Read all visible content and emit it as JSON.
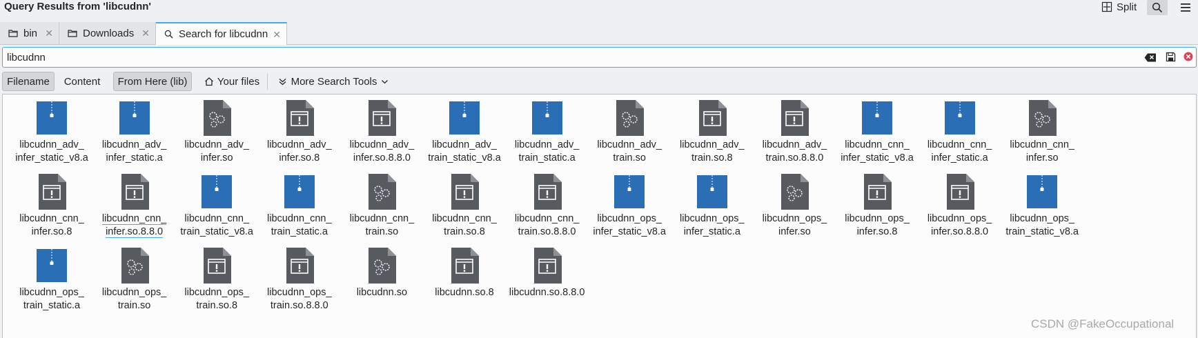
{
  "window": {
    "title": "Query Results from 'libcudnn'",
    "split_label": "Split"
  },
  "tabs": [
    {
      "label": "bin",
      "icon": "folder-icon",
      "active": false
    },
    {
      "label": "Downloads",
      "icon": "folder-icon",
      "active": false
    },
    {
      "label": "Search for libcudnn",
      "icon": "search-icon",
      "active": true
    }
  ],
  "search": {
    "value": "libcudnn"
  },
  "filters": {
    "filename": "Filename",
    "content": "Content",
    "from_here": "From Here (lib)",
    "your_files": "Your files",
    "more_tools": "More Search Tools"
  },
  "files": [
    {
      "name": "libcudnn_adv_\ninfer_static_v8.a",
      "type": "archive"
    },
    {
      "name": "libcudnn_adv_\ninfer_static.a",
      "type": "archive"
    },
    {
      "name": "libcudnn_adv_\ninfer.so",
      "type": "library"
    },
    {
      "name": "libcudnn_adv_\ninfer.so.8",
      "type": "executable"
    },
    {
      "name": "libcudnn_adv_\ninfer.so.8.8.0",
      "type": "executable"
    },
    {
      "name": "libcudnn_adv_\ntrain_static_v8.a",
      "type": "archive"
    },
    {
      "name": "libcudnn_adv_\ntrain_static.a",
      "type": "archive"
    },
    {
      "name": "libcudnn_adv_\ntrain.so",
      "type": "library"
    },
    {
      "name": "libcudnn_adv_\ntrain.so.8",
      "type": "executable"
    },
    {
      "name": "libcudnn_adv_\ntrain.so.8.8.0",
      "type": "executable"
    },
    {
      "name": "libcudnn_cnn_\ninfer_static_v8.a",
      "type": "archive"
    },
    {
      "name": "libcudnn_cnn_\ninfer_static.a",
      "type": "archive"
    },
    {
      "name": "libcudnn_cnn_\ninfer.so",
      "type": "library"
    },
    {
      "name": "libcudnn_cnn_\ninfer.so.8",
      "type": "executable"
    },
    {
      "name": "libcudnn_cnn_\ninfer.so.8.8.0",
      "type": "executable",
      "focused": true
    },
    {
      "name": "libcudnn_cnn_\ntrain_static_v8.a",
      "type": "archive"
    },
    {
      "name": "libcudnn_cnn_\ntrain_static.a",
      "type": "archive"
    },
    {
      "name": "libcudnn_cnn_\ntrain.so",
      "type": "library"
    },
    {
      "name": "libcudnn_cnn_\ntrain.so.8",
      "type": "executable"
    },
    {
      "name": "libcudnn_cnn_\ntrain.so.8.8.0",
      "type": "executable"
    },
    {
      "name": "libcudnn_ops_\ninfer_static_v8.a",
      "type": "archive"
    },
    {
      "name": "libcudnn_ops_\ninfer_static.a",
      "type": "archive"
    },
    {
      "name": "libcudnn_ops_\ninfer.so",
      "type": "library"
    },
    {
      "name": "libcudnn_ops_\ninfer.so.8",
      "type": "executable"
    },
    {
      "name": "libcudnn_ops_\ninfer.so.8.8.0",
      "type": "executable"
    },
    {
      "name": "libcudnn_ops_\ntrain_static_v8.a",
      "type": "archive"
    },
    {
      "name": "libcudnn_ops_\ntrain_static.a",
      "type": "archive"
    },
    {
      "name": "libcudnn_ops_\ntrain.so",
      "type": "library"
    },
    {
      "name": "libcudnn_ops_\ntrain.so.8",
      "type": "executable"
    },
    {
      "name": "libcudnn_ops_\ntrain.so.8.8.0",
      "type": "executable"
    },
    {
      "name": "libcudnn.so",
      "type": "library"
    },
    {
      "name": "libcudnn.so.8",
      "type": "executable"
    },
    {
      "name": "libcudnn.so.8.8.0",
      "type": "executable"
    }
  ],
  "watermark": "CSDN @FakeOccupational",
  "colors": {
    "accent": "#3daee9",
    "archive": "#2a6fb5",
    "binary": "#575b5f"
  }
}
